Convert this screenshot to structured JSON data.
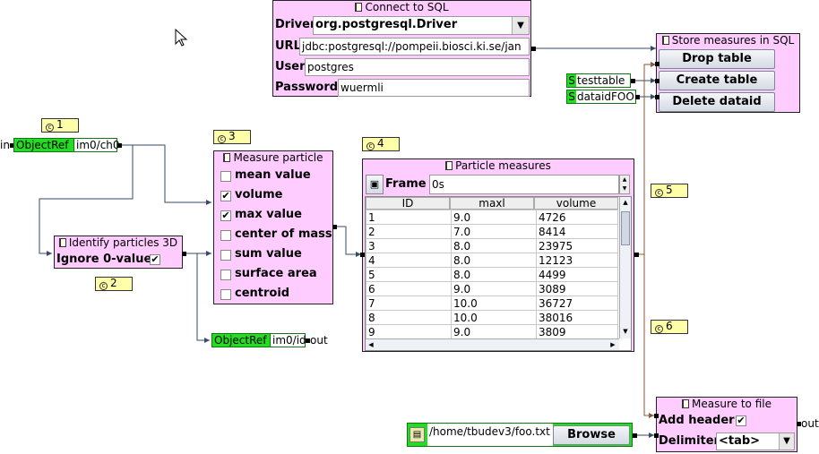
{
  "connect_sql": {
    "title": "Connect to SQL",
    "driver_label": "Driver",
    "driver_value": "org.postgresql.Driver",
    "url_label": "URL",
    "url_value": "jdbc:postgresql://pompeii.biosci.ki.se/jan",
    "user_label": "User",
    "user_value": "postgres",
    "password_label": "Password",
    "password_value": "wuermli"
  },
  "store_measures": {
    "title": "Store measures in SQL",
    "drop_label": "Drop table",
    "create_label": "Create table",
    "delete_label": "Delete dataid"
  },
  "string_inputs": {
    "s1_prefix": "S",
    "s1_value": "testtable",
    "s2_prefix": "S",
    "s2_value": "dataidFOO"
  },
  "notes": {
    "n1": "1",
    "n2": "2",
    "n3": "3",
    "n4": "4",
    "n5": "5",
    "n6": "6"
  },
  "input_objectref": {
    "in_label": "in",
    "type": "ObjectRef",
    "value": "im0/ch0"
  },
  "output_objectref": {
    "type": "ObjectRef",
    "value": "im0/id",
    "out_label": "out"
  },
  "identify": {
    "title": "Identify particles 3D",
    "ignore_label": "Ignore 0-value",
    "ignore_checked": "✔"
  },
  "measure_particle": {
    "title": "Measure particle",
    "options": [
      {
        "label": "mean value",
        "check": ""
      },
      {
        "label": "volume",
        "check": "✔"
      },
      {
        "label": "max value",
        "check": "✔"
      },
      {
        "label": "center of mass",
        "check": ""
      },
      {
        "label": "sum value",
        "check": ""
      },
      {
        "label": "surface area",
        "check": ""
      },
      {
        "label": "centroid",
        "check": ""
      }
    ]
  },
  "particle_measures": {
    "title": "Particle measures",
    "frame_label": "Frame",
    "frame_value": "0s",
    "columns": [
      "ID",
      "maxl",
      "volume"
    ],
    "rows": [
      [
        "1",
        "9.0",
        "4726"
      ],
      [
        "2",
        "7.0",
        "8414"
      ],
      [
        "3",
        "8.0",
        "23975"
      ],
      [
        "4",
        "8.0",
        "12123"
      ],
      [
        "5",
        "8.0",
        "4499"
      ],
      [
        "6",
        "9.0",
        "3089"
      ],
      [
        "7",
        "10.0",
        "36727"
      ],
      [
        "8",
        "10.0",
        "38016"
      ],
      [
        "9",
        "9.0",
        "3809"
      ]
    ]
  },
  "file_input": {
    "path": "/home/tbudev3/foo.txt",
    "browse_label": "Browse"
  },
  "measure_to_file": {
    "title": "Measure to file",
    "header_label": "Add header",
    "header_checked": "✔",
    "delimiter_label": "Delimiter",
    "delimiter_value": "<tab>",
    "out_label": "out"
  },
  "colors": {
    "node_bg": "#ffccff",
    "note_bg": "#ffffaa",
    "port_green": "#22dd22",
    "wire": "#3a4a6a",
    "wire_brown": "#8a5a3a"
  }
}
